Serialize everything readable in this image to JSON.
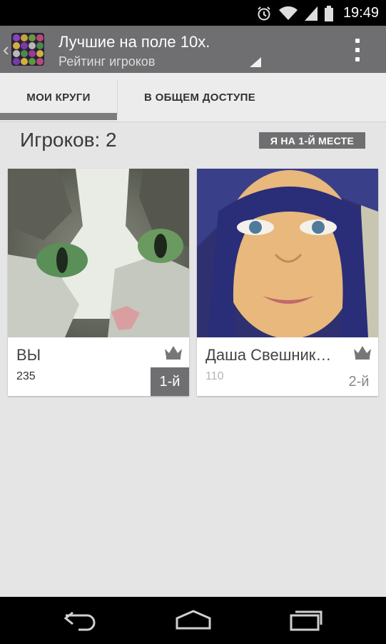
{
  "status_bar": {
    "time": "19:49"
  },
  "app_bar": {
    "title": "Лучшие на поле 10х.",
    "subtitle": "Рейтинг игроков"
  },
  "tabs": [
    {
      "label": "МОИ КРУГИ",
      "selected": true
    },
    {
      "label": "В ОБЩЕМ ДОСТУПЕ",
      "selected": false
    }
  ],
  "summary": {
    "players_count": "Игроков: 2",
    "rank_badge": "Я НА 1-Й МЕСТЕ"
  },
  "players": [
    {
      "name": "ВЫ",
      "score": "235",
      "place": "1-й",
      "photo": "cat-face-photo"
    },
    {
      "name": "Даша Свешник…",
      "score": "110",
      "place": "2-й",
      "photo": "girl-portrait-photo"
    }
  ],
  "colors": {
    "accent_gray": "#6f6e70",
    "background": "#e6e5e6",
    "status_bar": "#000000"
  },
  "icons": [
    "alarm-icon",
    "wifi-icon",
    "signal-icon",
    "battery-icon",
    "back-chevron-icon",
    "app-logo-icon",
    "overflow-menu-icon",
    "crown-icon",
    "nav-back-icon",
    "nav-home-icon",
    "nav-recents-icon"
  ]
}
